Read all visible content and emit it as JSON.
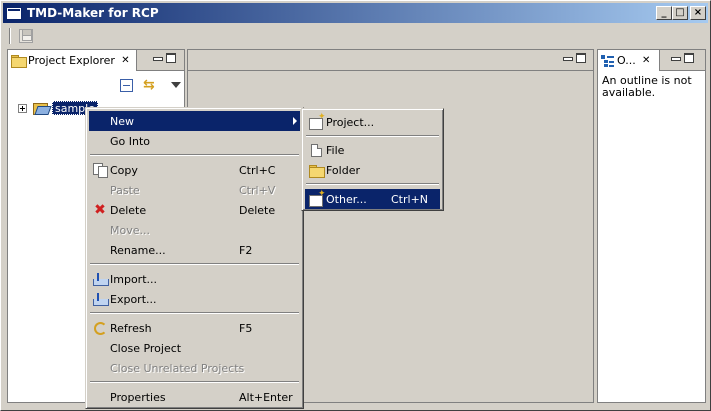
{
  "window": {
    "title": "TMD-Maker for RCP",
    "minimize_glyph": "_",
    "maximize_glyph": "□",
    "close_glyph": "×"
  },
  "explorer": {
    "tab_label": "Project Explorer",
    "tree": [
      {
        "label": "sample"
      }
    ]
  },
  "outline": {
    "tab_label": "O...",
    "message": "An outline is not available."
  },
  "context_menu": {
    "items": [
      {
        "label": "New",
        "accel": "",
        "enabled": true,
        "selected": true,
        "submenu": true,
        "icon": ""
      },
      {
        "label": "Go Into",
        "accel": "",
        "enabled": true,
        "icon": ""
      },
      {
        "label": "Copy",
        "accel": "Ctrl+C",
        "enabled": true,
        "icon": "copy-icon"
      },
      {
        "label": "Paste",
        "accel": "Ctrl+V",
        "enabled": false,
        "icon": "paste-icon"
      },
      {
        "label": "Delete",
        "accel": "Delete",
        "enabled": true,
        "icon": "delete-icon"
      },
      {
        "label": "Move...",
        "accel": "",
        "enabled": false,
        "icon": ""
      },
      {
        "label": "Rename...",
        "accel": "F2",
        "enabled": true,
        "icon": ""
      },
      {
        "label": "Import...",
        "accel": "",
        "enabled": true,
        "icon": "import-icon"
      },
      {
        "label": "Export...",
        "accel": "",
        "enabled": true,
        "icon": "export-icon"
      },
      {
        "label": "Refresh",
        "accel": "F5",
        "enabled": true,
        "icon": "refresh-icon"
      },
      {
        "label": "Close Project",
        "accel": "",
        "enabled": true,
        "icon": ""
      },
      {
        "label": "Close Unrelated Projects",
        "accel": "",
        "enabled": false,
        "icon": ""
      },
      {
        "label": "Properties",
        "accel": "Alt+Enter",
        "enabled": true,
        "icon": ""
      }
    ]
  },
  "submenu": {
    "items": [
      {
        "label": "Project...",
        "accel": "",
        "icon": "new-project-icon"
      },
      {
        "label": "File",
        "accel": "",
        "icon": "new-file-icon"
      },
      {
        "label": "Folder",
        "accel": "",
        "icon": "new-folder-icon"
      },
      {
        "label": "Other...",
        "accel": "Ctrl+N",
        "icon": "new-other-icon",
        "selected": true
      }
    ]
  },
  "colors": {
    "selection": "#0a246a",
    "chrome": "#d4d0c8"
  }
}
